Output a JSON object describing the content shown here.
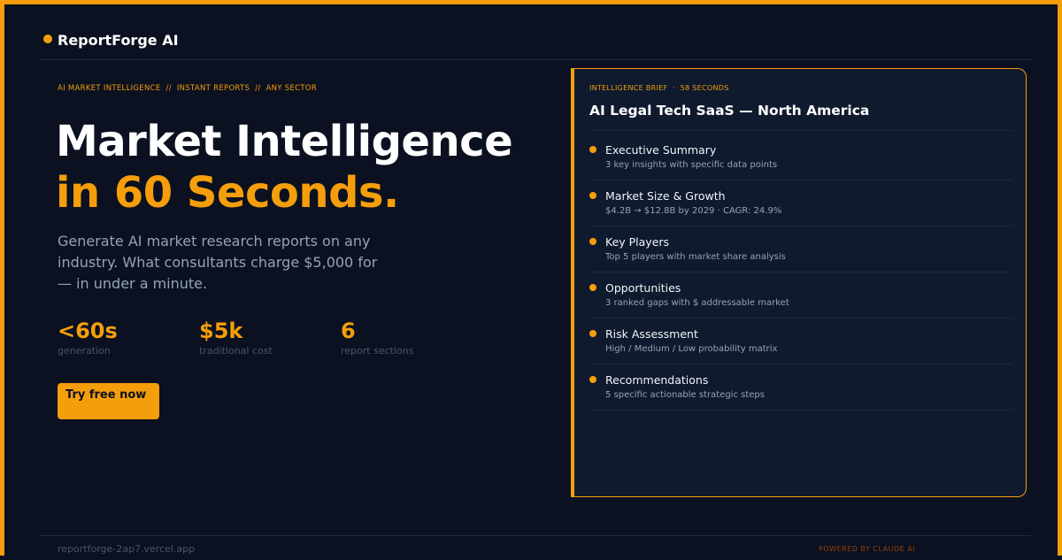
{
  "brand": {
    "name": "ReportForge AI",
    "accent_color": "#f59e0b",
    "background_color": "#0b1120"
  },
  "hero": {
    "tagline": "AI MARKET INTELLIGENCE  //  INSTANT REPORTS  //  ANY SECTOR",
    "headline_line1": "Market Intelligence",
    "headline_line2": "in 60 Seconds.",
    "subtitle": "Generate AI market research reports on any industry. What consultants charge $5,000 for — in under a minute.",
    "stats": [
      {
        "value": "<60s",
        "label": "generation"
      },
      {
        "value": "$5k",
        "label": "traditional cost"
      },
      {
        "value": "6",
        "label": "report sections"
      }
    ],
    "cta_label": "Try free now"
  },
  "brief_card": {
    "label": "INTELLIGENCE BRIEF  ·  58 SECONDS",
    "title": "AI Legal Tech SaaS — North America",
    "bullet_icon": "dot-bullet-icon",
    "items": [
      {
        "title": "Executive Summary",
        "desc": "3 key insights with specific data points"
      },
      {
        "title": "Market Size & Growth",
        "desc": "$4.2B → $12.8B by 2029  ·  CAGR: 24.9%"
      },
      {
        "title": "Key Players",
        "desc": "Top 5 players with market share analysis"
      },
      {
        "title": "Opportunities",
        "desc": "3 ranked gaps with $ addressable market"
      },
      {
        "title": "Risk Assessment",
        "desc": "High / Medium / Low probability matrix"
      },
      {
        "title": "Recommendations",
        "desc": "5 specific actionable strategic steps"
      }
    ]
  },
  "footer": {
    "url": "reportforge-2ap7.vercel.app",
    "powered_by": "POWERED BY CLAUDE AI"
  }
}
